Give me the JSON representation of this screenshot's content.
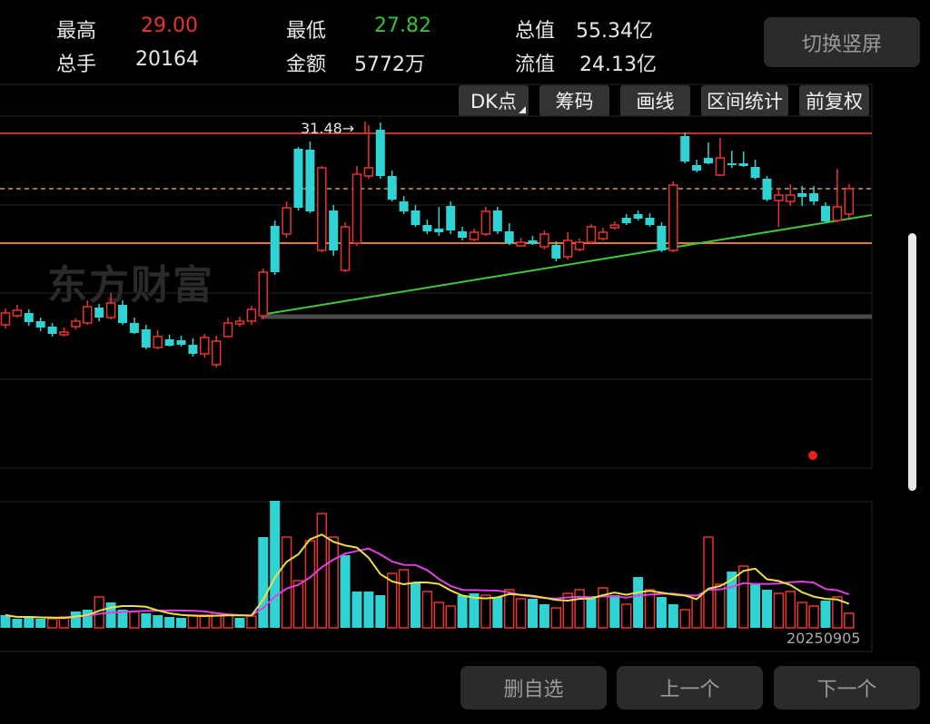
{
  "header": {
    "high_label": "最高",
    "high_value": "29.00",
    "low_label": "最低",
    "low_value": "27.82",
    "total_value_label": "总值",
    "total_value": "55.34亿",
    "volume_label": "总手",
    "volume_value": "20164",
    "amount_label": "金额",
    "amount_value": "5772万",
    "float_value_label": "流值",
    "float_value": "24.13亿",
    "switch_button": "切换竖屏"
  },
  "toolbar": {
    "dk": "DK点",
    "chips": "筹码",
    "draw": "画线",
    "interval": "区间统计",
    "adjust": "前复权"
  },
  "chart": {
    "max_annotation": "31.48→",
    "watermark": "东方财富",
    "date_label": "20250905"
  },
  "footer": {
    "delete_fav": "删自选",
    "prev": "上一个",
    "next": "下一个"
  },
  "colors": {
    "up": "#e8342e",
    "down": "#2fd3d3",
    "ma5": "#e8e04a",
    "ma10": "#e040e0",
    "trend": "#3ec83e",
    "hline_red": "#c8302a",
    "hline_orange": "#e07a26"
  },
  "chart_data": {
    "type": "candlestick",
    "candles": [
      [
        358,
        345,
        340,
        362,
        1
      ],
      [
        348,
        342,
        336,
        350,
        1
      ],
      [
        345,
        355,
        341,
        359,
        0
      ],
      [
        354,
        361,
        350,
        365,
        0
      ],
      [
        360,
        368,
        356,
        371,
        0
      ],
      [
        369,
        366,
        361,
        371,
        1
      ],
      [
        360,
        354,
        351,
        363,
        1
      ],
      [
        356,
        338,
        331,
        358,
        1
      ],
      [
        339,
        350,
        335,
        354,
        0
      ],
      [
        350,
        334,
        323,
        352,
        1
      ],
      [
        336,
        356,
        331,
        358,
        0
      ],
      [
        356,
        367,
        350,
        368,
        0
      ],
      [
        363,
        383,
        358,
        385,
        0
      ],
      [
        383,
        371,
        364,
        385,
        1
      ],
      [
        374,
        381,
        369,
        382,
        0
      ],
      [
        375,
        380,
        370,
        382,
        0
      ],
      [
        380,
        390,
        373,
        393,
        0
      ],
      [
        390,
        372,
        368,
        394,
        1
      ],
      [
        376,
        402,
        370,
        405,
        1
      ],
      [
        371,
        356,
        350,
        372,
        1
      ],
      [
        357,
        354,
        349,
        360,
        1
      ],
      [
        354,
        341,
        337,
        358,
        1
      ],
      [
        300,
        348,
        296,
        352,
        1
      ],
      [
        249,
        300,
        243,
        303,
        0
      ],
      [
        229,
        258,
        222,
        262,
        1
      ],
      [
        164,
        229,
        162,
        232,
        0
      ],
      [
        165,
        233,
        156,
        235,
        0
      ],
      [
        185,
        276,
        183,
        278,
        1
      ],
      [
        232,
        276,
        226,
        282,
        0
      ],
      [
        250,
        298,
        245,
        300,
        1
      ],
      [
        192,
        268,
        183,
        271,
        1
      ],
      [
        185,
        194,
        138,
        197,
        1
      ],
      [
        143,
        194,
        135,
        197,
        0
      ],
      [
        194,
        220,
        188,
        222,
        0
      ],
      [
        222,
        233,
        216,
        236,
        0
      ],
      [
        232,
        248,
        226,
        250,
        0
      ],
      [
        248,
        255,
        242,
        258,
        0
      ],
      [
        252,
        256,
        228,
        260,
        0
      ],
      [
        227,
        254,
        222,
        258,
        0
      ],
      [
        255,
        262,
        250,
        265,
        0
      ],
      [
        256,
        264,
        252,
        266,
        1
      ],
      [
        233,
        258,
        228,
        260,
        1
      ],
      [
        232,
        255,
        228,
        258,
        0
      ],
      [
        255,
        268,
        246,
        270,
        0
      ],
      [
        267,
        271,
        262,
        272,
        1
      ],
      [
        265,
        269,
        260,
        270,
        0
      ],
      [
        258,
        272,
        254,
        275,
        1
      ],
      [
        270,
        285,
        266,
        288,
        0
      ],
      [
        265,
        283,
        256,
        286,
        1
      ],
      [
        267,
        275,
        263,
        277,
        1
      ],
      [
        250,
        267,
        247,
        269,
        1
      ],
      [
        256,
        263,
        251,
        265,
        1
      ],
      [
        248,
        251,
        244,
        253,
        1
      ],
      [
        240,
        246,
        236,
        248,
        0
      ],
      [
        236,
        241,
        232,
        243,
        0
      ],
      [
        240,
        248,
        235,
        250,
        0
      ],
      [
        249,
        276,
        245,
        278,
        0
      ],
      [
        204,
        276,
        200,
        278,
        1
      ],
      [
        150,
        178,
        146,
        180,
        0
      ],
      [
        182,
        188,
        176,
        190,
        0
      ],
      [
        174,
        180,
        157,
        181,
        0
      ],
      [
        174,
        193,
        152,
        194,
        1
      ],
      [
        180,
        182,
        166,
        185,
        0
      ],
      [
        180,
        183,
        167,
        184,
        0
      ],
      [
        184,
        196,
        176,
        198,
        0
      ],
      [
        197,
        220,
        194,
        222,
        0
      ],
      [
        215,
        221,
        207,
        250,
        1
      ],
      [
        215,
        222,
        203,
        227,
        1
      ],
      [
        213,
        217,
        205,
        227,
        0
      ],
      [
        213,
        222,
        205,
        226,
        0
      ],
      [
        227,
        244,
        223,
        246,
        0
      ],
      [
        228,
        243,
        186,
        245,
        1
      ],
      [
        208,
        236,
        203,
        240,
        1
      ]
    ],
    "volumes": [
      [
        14,
        0
      ],
      [
        10,
        0
      ],
      [
        12,
        0
      ],
      [
        10,
        0
      ],
      [
        10,
        1
      ],
      [
        12,
        1
      ],
      [
        18,
        0
      ],
      [
        20,
        0
      ],
      [
        34,
        1
      ],
      [
        28,
        0
      ],
      [
        20,
        0
      ],
      [
        18,
        1
      ],
      [
        16,
        0
      ],
      [
        14,
        0
      ],
      [
        12,
        0
      ],
      [
        11,
        0
      ],
      [
        14,
        1
      ],
      [
        14,
        1
      ],
      [
        16,
        1
      ],
      [
        14,
        1
      ],
      [
        11,
        0
      ],
      [
        13,
        1
      ],
      [
        100,
        0
      ],
      [
        140,
        0
      ],
      [
        100,
        1
      ],
      [
        52,
        1
      ],
      [
        96,
        1
      ],
      [
        126,
        1
      ],
      [
        100,
        1
      ],
      [
        80,
        0
      ],
      [
        40,
        0
      ],
      [
        40,
        0
      ],
      [
        36,
        0
      ],
      [
        60,
        1
      ],
      [
        64,
        1
      ],
      [
        50,
        0
      ],
      [
        40,
        1
      ],
      [
        28,
        1
      ],
      [
        24,
        1
      ],
      [
        36,
        0
      ],
      [
        38,
        0
      ],
      [
        36,
        1
      ],
      [
        34,
        0
      ],
      [
        42,
        1
      ],
      [
        32,
        1
      ],
      [
        32,
        0
      ],
      [
        26,
        0
      ],
      [
        22,
        1
      ],
      [
        38,
        1
      ],
      [
        42,
        1
      ],
      [
        34,
        0
      ],
      [
        44,
        1
      ],
      [
        36,
        0
      ],
      [
        26,
        1
      ],
      [
        56,
        0
      ],
      [
        42,
        1
      ],
      [
        34,
        0
      ],
      [
        26,
        0
      ],
      [
        20,
        1
      ],
      [
        36,
        1
      ],
      [
        100,
        1
      ],
      [
        48,
        1
      ],
      [
        62,
        0
      ],
      [
        68,
        1
      ],
      [
        48,
        0
      ],
      [
        42,
        0
      ],
      [
        38,
        1
      ],
      [
        40,
        1
      ],
      [
        28,
        1
      ],
      [
        24,
        1
      ],
      [
        30,
        0
      ],
      [
        34,
        1
      ],
      [
        16,
        1
      ]
    ]
  }
}
